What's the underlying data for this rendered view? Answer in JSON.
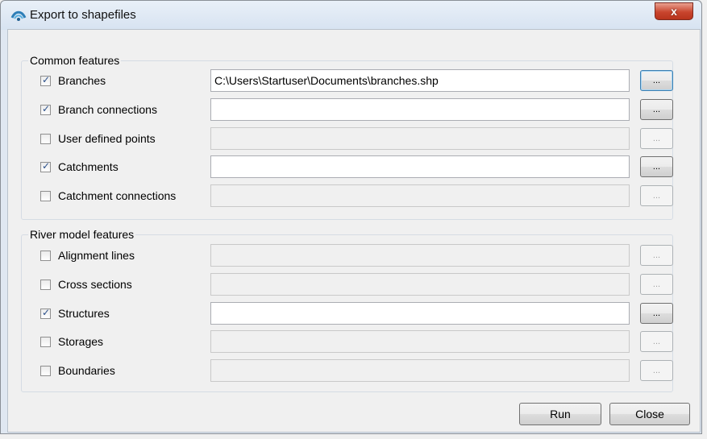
{
  "window": {
    "title": "Export to shapefiles",
    "close_label": "x"
  },
  "common": {
    "legend": "Common features",
    "rows": [
      {
        "label": "Branches",
        "checked": true,
        "path": "C:\\Users\\Startuser\\Documents\\branches.shp",
        "enabled": true,
        "focused": true
      },
      {
        "label": "Branch connections",
        "checked": true,
        "path": "",
        "enabled": true,
        "focused": false
      },
      {
        "label": "User defined points",
        "checked": false,
        "path": "",
        "enabled": false,
        "focused": false
      },
      {
        "label": "Catchments",
        "checked": true,
        "path": "",
        "enabled": true,
        "focused": false
      },
      {
        "label": "Catchment connections",
        "checked": false,
        "path": "",
        "enabled": false,
        "focused": false
      }
    ]
  },
  "river": {
    "legend": "River model features",
    "rows": [
      {
        "label": "Alignment lines",
        "checked": false,
        "path": "",
        "enabled": false,
        "focused": false
      },
      {
        "label": "Cross sections",
        "checked": false,
        "path": "",
        "enabled": false,
        "focused": false
      },
      {
        "label": "Structures",
        "checked": true,
        "path": "",
        "enabled": true,
        "focused": false
      },
      {
        "label": "Storages",
        "checked": false,
        "path": "",
        "enabled": false,
        "focused": false
      },
      {
        "label": "Boundaries",
        "checked": false,
        "path": "",
        "enabled": false,
        "focused": false
      }
    ]
  },
  "browse_label": "...",
  "buttons": {
    "run": "Run",
    "close": "Close"
  },
  "icons": {
    "title": "dhi-wave-icon",
    "close": "close-icon"
  }
}
